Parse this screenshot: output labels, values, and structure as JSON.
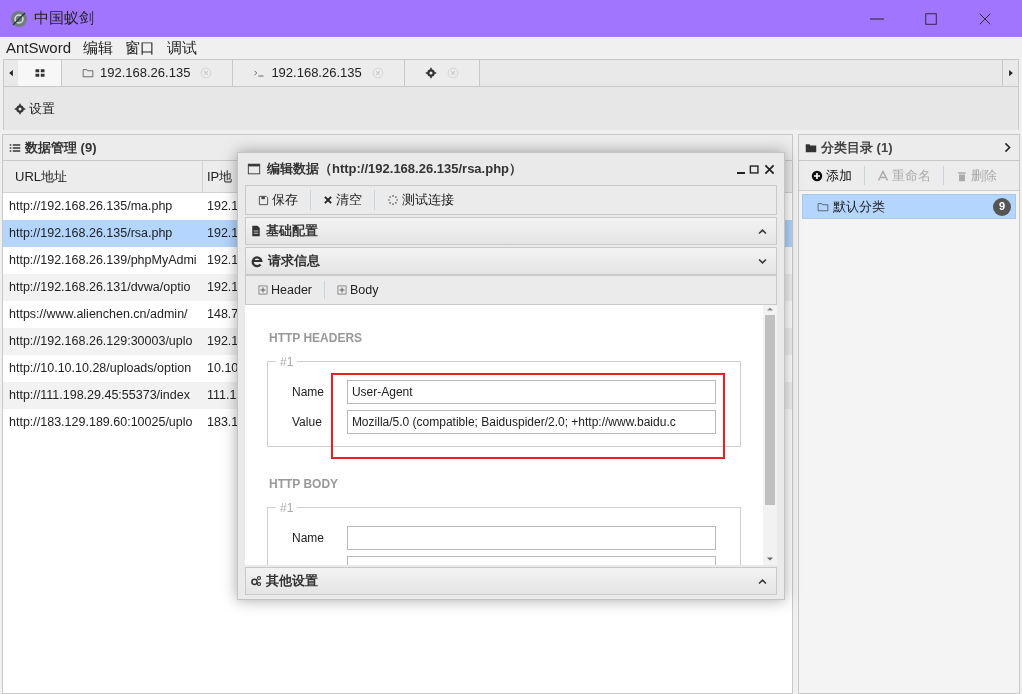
{
  "window": {
    "title": "中国蚁剑"
  },
  "menu": [
    "AntSword",
    "编辑",
    "窗口",
    "调试"
  ],
  "tabs": [
    {
      "kind": "home",
      "selected": true
    },
    {
      "kind": "files",
      "label": "192.168.26.135",
      "selected": false
    },
    {
      "kind": "terminal",
      "label": "192.168.26.135",
      "selected": false
    },
    {
      "kind": "settings",
      "selected": false
    }
  ],
  "toolbar": {
    "settings_button": "设置"
  },
  "data_panel": {
    "title": "数据管理 (9)",
    "columns": [
      "URL地址",
      "IP地"
    ],
    "rows": [
      {
        "url": "http://192.168.26.135/ma.php",
        "ip": "192.1",
        "selected": false
      },
      {
        "url": "http://192.168.26.135/rsa.php",
        "ip": "192.1",
        "selected": true
      },
      {
        "url": "http://192.168.26.139/phpMyAdmi",
        "ip": "192.1",
        "selected": false
      },
      {
        "url": "http://192.168.26.131/dvwa/optio",
        "ip": "192.1",
        "selected": false
      },
      {
        "url": "https://www.alienchen.cn/admin/",
        "ip": "148.7",
        "selected": false
      },
      {
        "url": "http://192.168.26.129:30003/uplo",
        "ip": "192.1",
        "selected": false
      },
      {
        "url": "http://10.10.10.28/uploads/option",
        "ip": "10.10",
        "selected": false
      },
      {
        "url": "http://111.198.29.45:55373/index",
        "ip": "111.1",
        "selected": false
      },
      {
        "url": "http://183.129.189.60:10025/uplo",
        "ip": "183.1",
        "selected": false
      }
    ]
  },
  "category_panel": {
    "title": "分类目录 (1)",
    "buttons": [
      {
        "kind": "add",
        "label": "添加",
        "disabled": false
      },
      {
        "kind": "rename",
        "label": "重命名",
        "disabled": true
      },
      {
        "kind": "delete",
        "label": "删除",
        "disabled": true
      }
    ],
    "items": [
      {
        "label": "默认分类",
        "count": "9",
        "selected": true
      }
    ]
  },
  "dialog": {
    "title": "编辑数据（http://192.168.26.135/rsa.php）",
    "toolbar": [
      {
        "kind": "save",
        "label": "保存"
      },
      {
        "kind": "clear",
        "label": "清空"
      },
      {
        "kind": "test",
        "label": "测试连接"
      }
    ],
    "sections": [
      {
        "kind": "basic",
        "title": "基础配置",
        "expanded": false
      },
      {
        "kind": "request",
        "title": "请求信息",
        "expanded": true
      },
      {
        "kind": "other",
        "title": "其他设置",
        "expanded": false
      }
    ],
    "request": {
      "tabs": [
        "Header",
        "Body"
      ],
      "headers_title": "HTTP HEADERS",
      "headers": [
        {
          "index": "#1",
          "name_label": "Name",
          "name": "User-Agent",
          "value_label": "Value",
          "value": "Mozilla/5.0 (compatible; Baiduspider/2.0; +http://www.baidu.c"
        }
      ],
      "body_title": "HTTP BODY",
      "body": [
        {
          "index": "#1",
          "name_label": "Name"
        }
      ]
    }
  }
}
